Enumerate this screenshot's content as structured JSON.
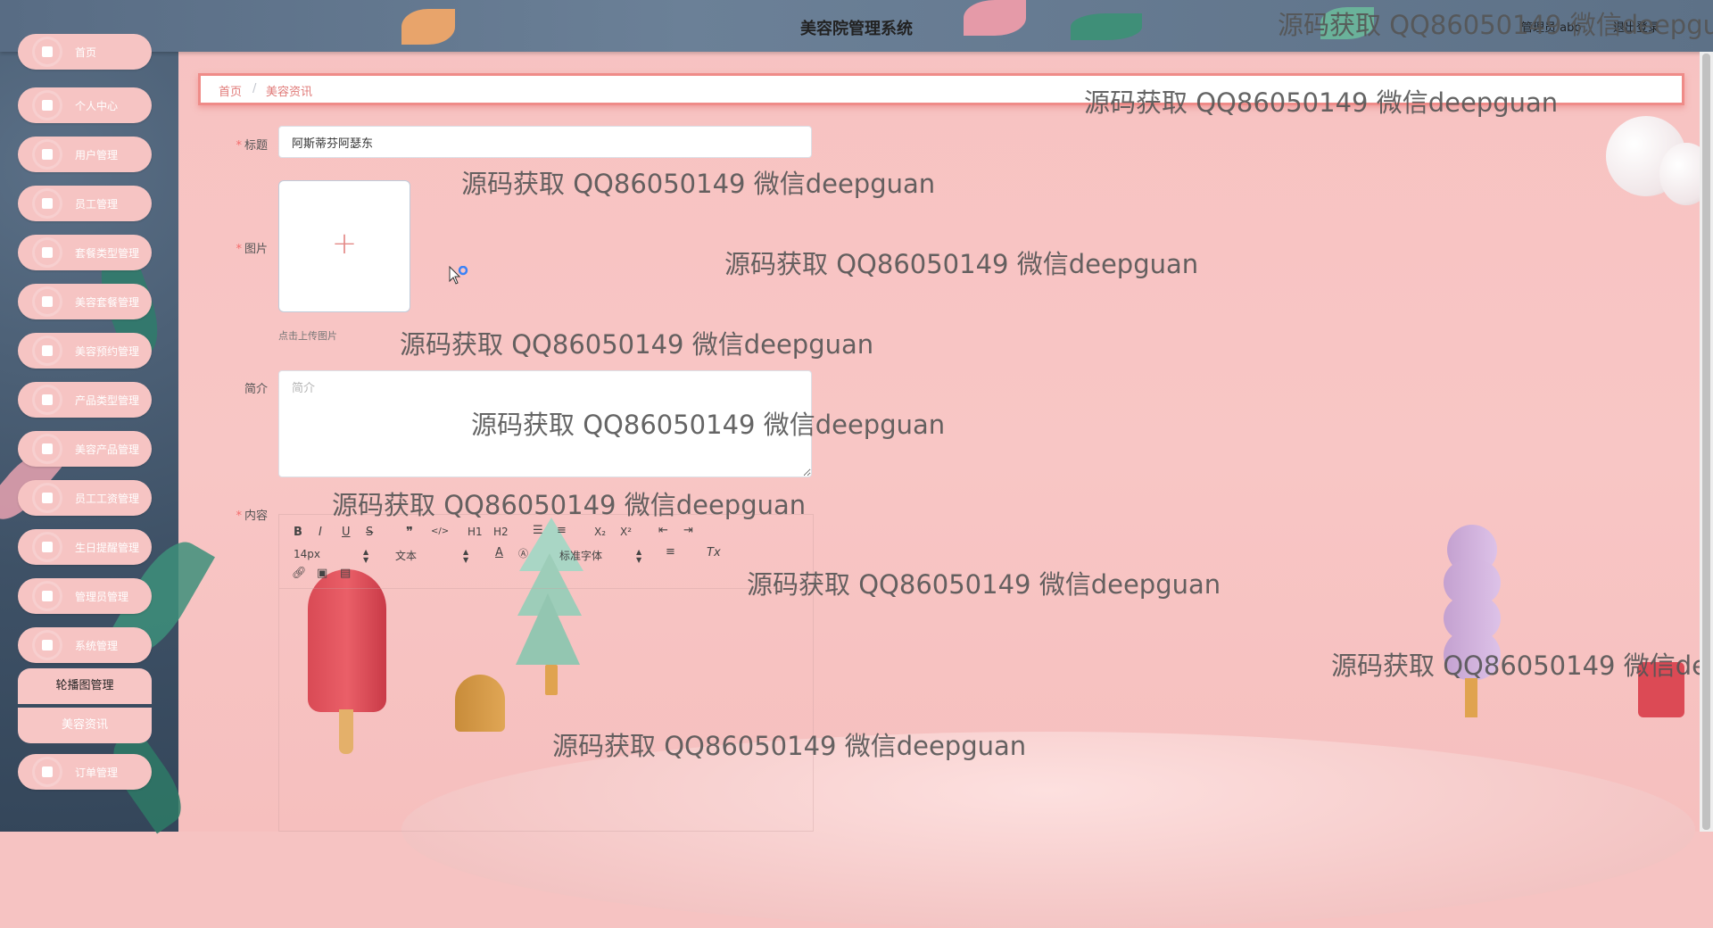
{
  "app": {
    "title": "美容院管理系统",
    "user_label": "管理员 abo",
    "logout_label": "退出登录"
  },
  "sidebar": {
    "items": [
      {
        "label": "首页",
        "icon": "home-icon"
      },
      {
        "label": "个人中心",
        "icon": "user-icon"
      },
      {
        "label": "用户管理",
        "icon": "menu-icon"
      },
      {
        "label": "员工管理",
        "icon": "staff-icon"
      },
      {
        "label": "套餐类型管理",
        "icon": "monitor-icon"
      },
      {
        "label": "美容套餐管理",
        "icon": "grid-icon"
      },
      {
        "label": "美容预约管理",
        "icon": "chat-icon"
      },
      {
        "label": "产品类型管理",
        "icon": "grid-icon"
      },
      {
        "label": "美容产品管理",
        "icon": "grid-icon"
      },
      {
        "label": "员工工资管理",
        "icon": "grid-icon"
      },
      {
        "label": "生日提醒管理",
        "icon": "calendar-icon"
      },
      {
        "label": "管理员管理",
        "icon": "clipboard-icon"
      },
      {
        "label": "系统管理",
        "icon": "grid-icon"
      }
    ],
    "submenu": [
      "轮播图管理",
      "美容资讯"
    ],
    "last_item": {
      "label": "订单管理",
      "icon": "grid-icon"
    }
  },
  "breadcrumb": {
    "home": "首页",
    "separator": "/",
    "current": "美容资讯"
  },
  "form": {
    "title_label": "标题",
    "title_value": "阿斯蒂芬阿瑟东",
    "image_label": "图片",
    "upload_tip": "点击上传图片",
    "intro_label": "简介",
    "intro_placeholder": "简介",
    "content_label": "内容"
  },
  "editor": {
    "font_size": "14px",
    "paragraph": "文本",
    "font_family": "标准字体",
    "buttons": [
      "B",
      "I",
      "U",
      "S",
      "❞",
      "</>",
      "H1",
      "H2",
      "ol",
      "ul",
      "X₂",
      "X²",
      "outdent",
      "indent",
      "A",
      "bg",
      "align",
      "Tx",
      "link",
      "image",
      "video"
    ]
  },
  "watermark": "源码获取 QQ86050149 微信deepguan",
  "colors": {
    "accent": "#e07a78",
    "menu_bg": "#f6c4c3",
    "required": "#f56c6c"
  }
}
